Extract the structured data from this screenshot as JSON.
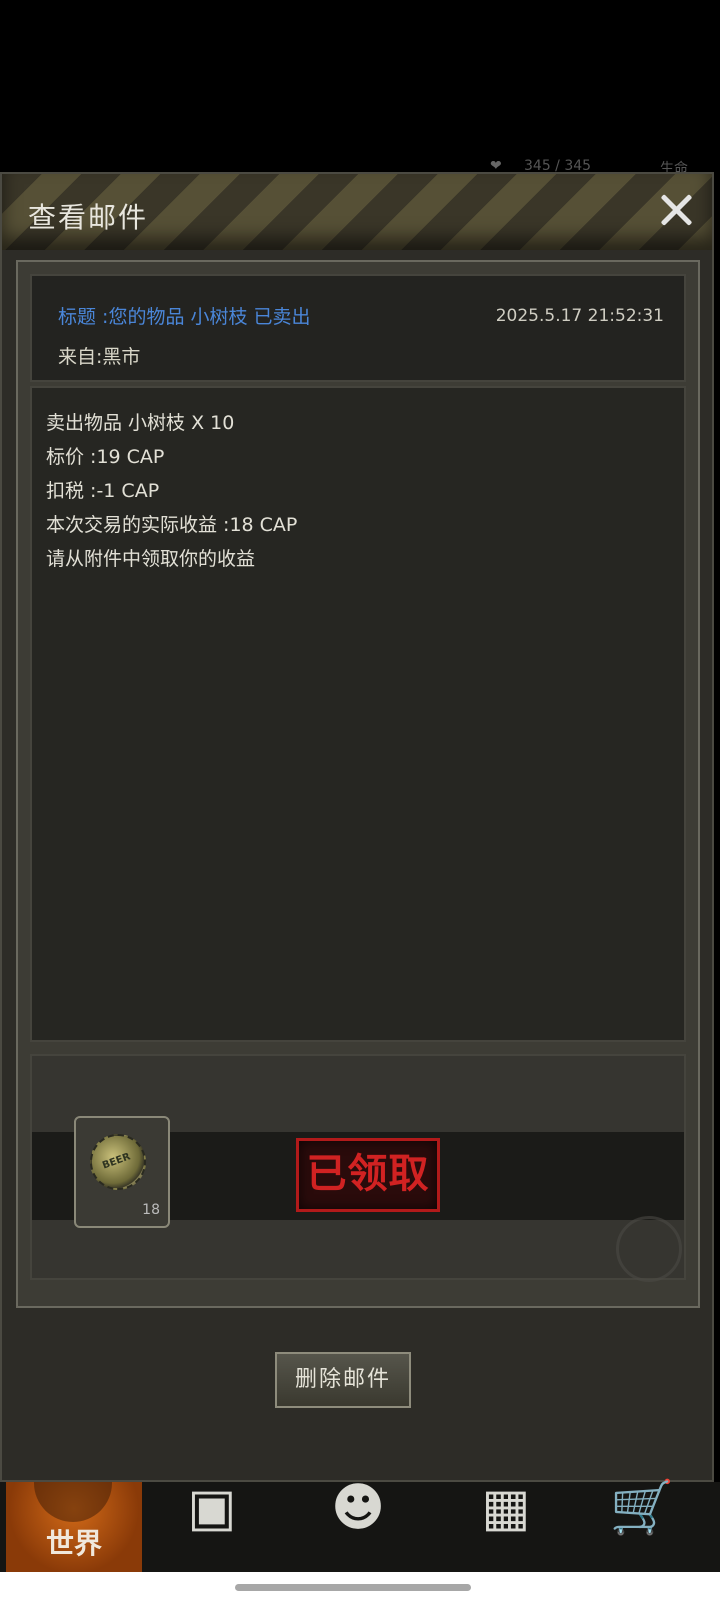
{
  "background": {
    "hp": "345 / 345",
    "life_label": "生命"
  },
  "dialog": {
    "title": "查看邮件",
    "mail": {
      "subject": "标题 :您的物品 小树枝 已卖出",
      "date": "2025.5.17 21:52:31",
      "sender": "来自:黑市",
      "body_lines": [
        "卖出物品 小树枝 X 10",
        "标价 :19 CAP",
        "扣税 :-1 CAP",
        "本次交易的实际收益 :18 CAP",
        "请从附件中领取你的收益"
      ]
    },
    "attachment": {
      "item_icon": "bottle-cap-icon",
      "item_count": "18",
      "claimed_label": "已领取"
    },
    "delete_label": "删除邮件"
  },
  "nav": {
    "world_label": "世界",
    "icons": [
      "backpack-icon",
      "head-icon",
      "phone-icon",
      "cart-icon"
    ]
  },
  "colors": {
    "subject": "#4a86d8",
    "stamp_red": "#d12222",
    "nav_world": "#d26a18"
  }
}
